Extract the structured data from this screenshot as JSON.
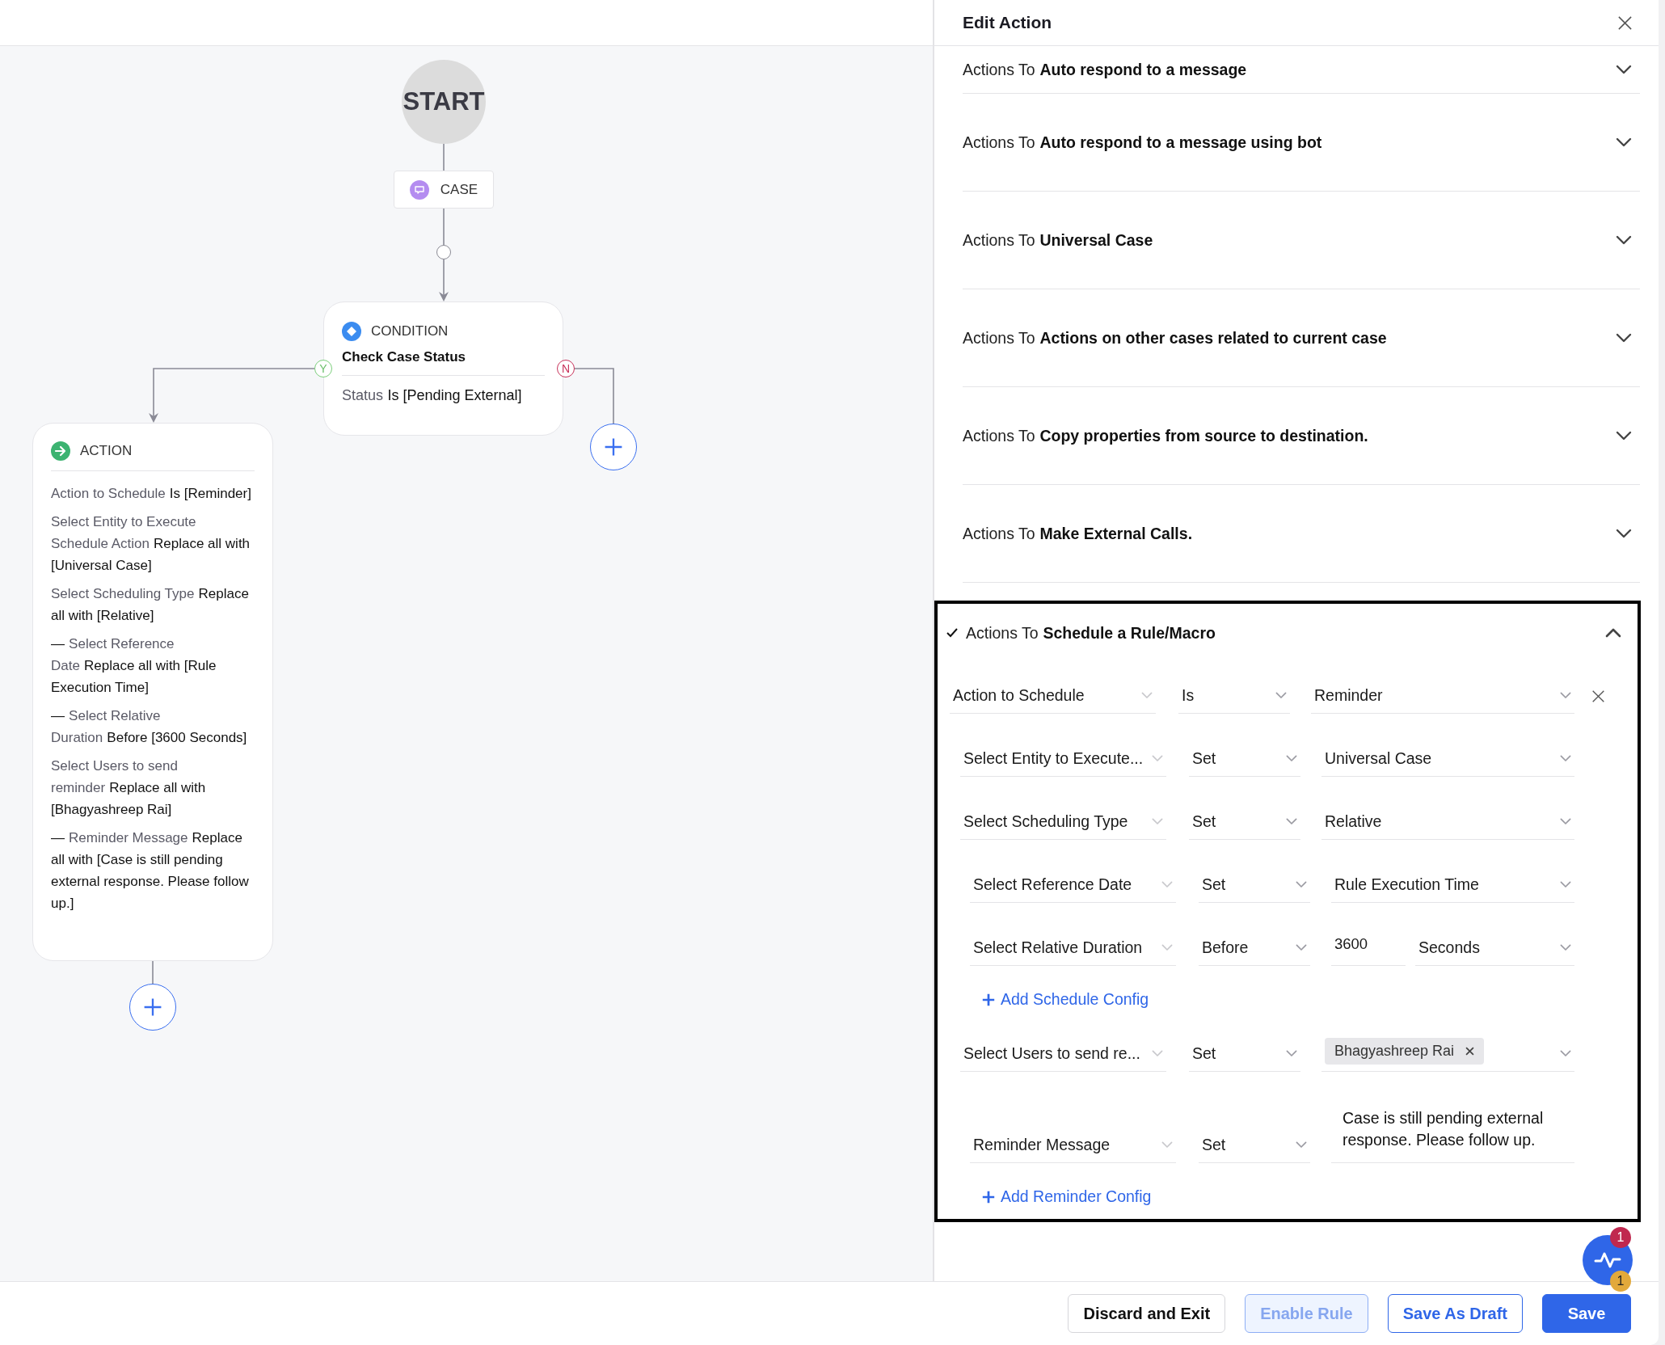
{
  "canvas": {
    "start_node": {
      "label": "START"
    },
    "trigger_node": {
      "label": "CASE"
    },
    "condition_node": {
      "type_label": "CONDITION",
      "title": "Check Case Status",
      "summary": {
        "field": "Status",
        "value": "Is [Pending External]"
      },
      "branches": [
        {
          "kind": "yes",
          "label": "Y"
        },
        {
          "kind": "no",
          "label": "N"
        }
      ]
    },
    "action_node": {
      "type_label": "ACTION",
      "lines": [
        {
          "field": "Action to Schedule",
          "value": "Is [Reminder]"
        },
        {
          "field": "Select Entity to Execute Schedule Action",
          "value": "Replace all with [Universal Case]"
        },
        {
          "field": "Select Scheduling Type",
          "value": "Replace all with [Relative]"
        },
        {
          "prefix": "—",
          "field": "Select Reference Date",
          "value": "Replace all with [Rule Execution Time]"
        },
        {
          "prefix": "—",
          "field": "Select Relative Duration",
          "value": "Before [3600 Seconds]"
        },
        {
          "field": "Select Users to send reminder",
          "value": "Replace all with [Bhagyashreep Rai]"
        },
        {
          "prefix": "—",
          "field": "Reminder Message",
          "value": "Replace all with [Case is still pending external response. Please follow up.]"
        }
      ]
    }
  },
  "panel": {
    "title": "Edit Action",
    "sections": [
      {
        "prefix": "Actions To",
        "name": "Auto respond to a message",
        "expanded": false,
        "checked": false
      },
      {
        "prefix": "Actions To",
        "name": "Auto respond to a message using bot",
        "expanded": false,
        "checked": false
      },
      {
        "prefix": "Actions To",
        "name": "Universal Case",
        "expanded": false,
        "checked": false
      },
      {
        "prefix": "Actions To",
        "name": "Actions on other cases related to current case",
        "expanded": false,
        "checked": false
      },
      {
        "prefix": "Actions To",
        "name": "Copy properties from source to destination.",
        "expanded": false,
        "checked": false
      },
      {
        "prefix": "Actions To",
        "name": "Make External Calls.",
        "expanded": false,
        "checked": false
      },
      {
        "prefix": "Actions To",
        "name": "Schedule a Rule/Macro",
        "expanded": true,
        "checked": true,
        "rows": [
          {
            "field": "Action to Schedule",
            "operator": "Is",
            "kind": "select",
            "value": "Reminder",
            "removable": true,
            "children": [
              {
                "field": "Select Entity to Execute...",
                "operator": "Set",
                "kind": "select",
                "value": "Universal Case",
                "removable": false
              },
              {
                "field": "Select Scheduling Type",
                "operator": "Set",
                "kind": "select",
                "value": "Relative",
                "removable": false,
                "children": [
                  {
                    "field": "Select Reference Date",
                    "operator": "Set",
                    "kind": "select",
                    "value": "Rule Execution Time",
                    "removable": false
                  },
                  {
                    "field": "Select Relative Duration",
                    "operator": "Before",
                    "kind": "number_unit",
                    "value": "3600",
                    "unit": "Seconds",
                    "removable": false
                  }
                ],
                "add_label": "Add Schedule Config"
              },
              {
                "field": "Select Users to send re...",
                "operator": "Set",
                "kind": "tags",
                "tags": [
                  "Bhagyashreep Rai"
                ],
                "removable": false,
                "children": [
                  {
                    "field": "Reminder Message",
                    "operator": "Set",
                    "kind": "text",
                    "value": "Case is still pending external response. Please follow up.",
                    "removable": false
                  }
                ],
                "add_label": "Add Reminder Config"
              }
            ]
          }
        ]
      }
    ]
  },
  "footer": {
    "buttons": [
      {
        "label": "Discard and Exit",
        "kind": "neutral",
        "disabled": false
      },
      {
        "label": "Enable Rule",
        "kind": "secondary",
        "disabled": true
      },
      {
        "label": "Save As Draft",
        "kind": "secondary",
        "disabled": false
      },
      {
        "label": "Save",
        "kind": "primary",
        "disabled": false
      }
    ],
    "widget": {
      "badges": [
        {
          "count": "1",
          "color": "#c0284f"
        },
        {
          "count": "1",
          "color": "#e2a93b"
        }
      ]
    }
  }
}
